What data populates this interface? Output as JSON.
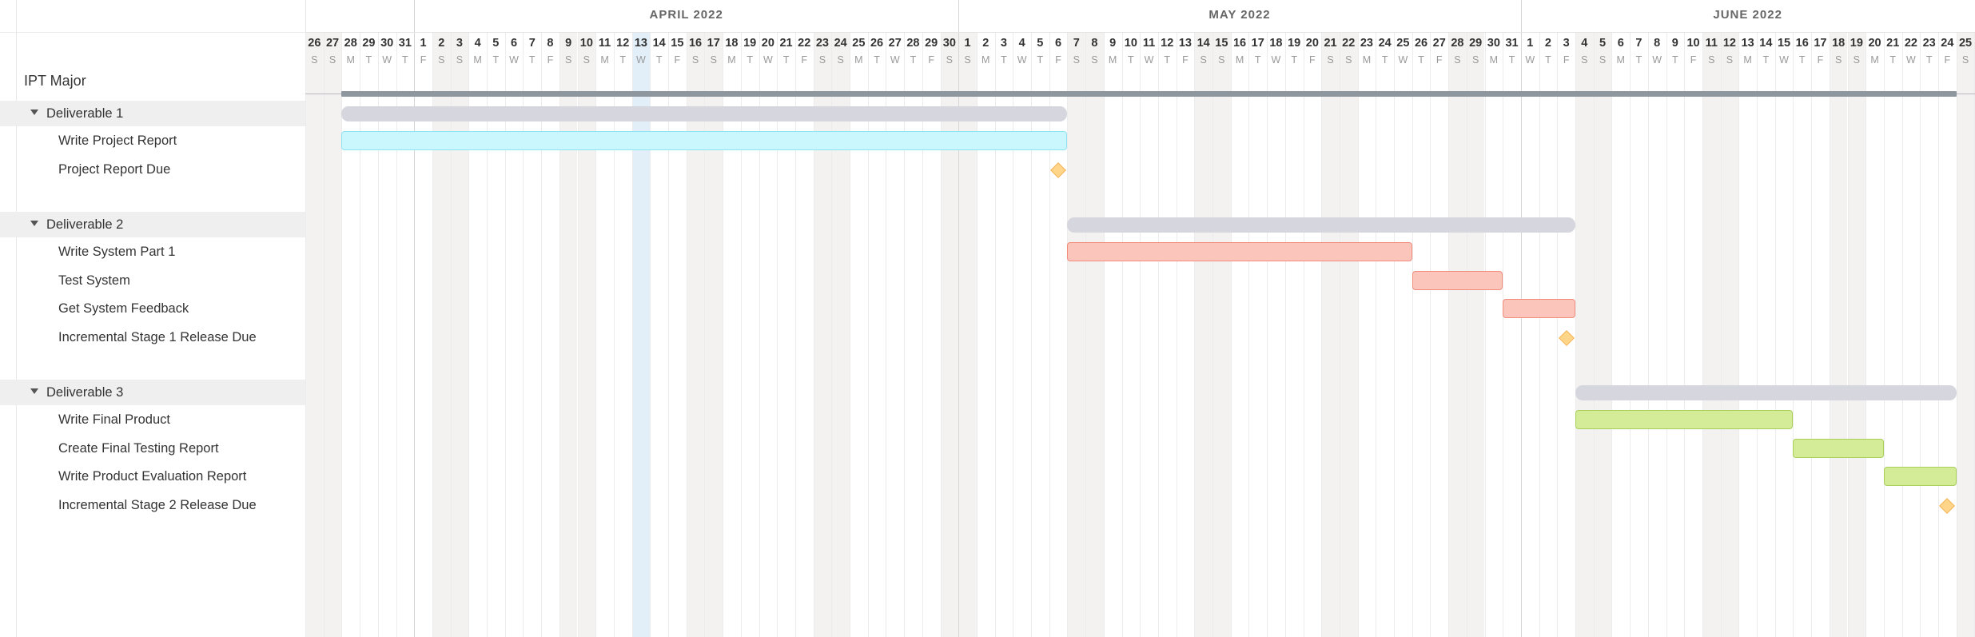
{
  "project": {
    "title": "IPT Major"
  },
  "colors": {
    "project_bar": "#8e969e",
    "summary_bar": "#d6d6de",
    "deliverable1": "#c9f7fd",
    "deliverable2": "#fcc5bb",
    "deliverable3": "#d4ec98",
    "milestone": "#ffd58a",
    "weekend": "#f3f2f0",
    "today": "#e2eff8"
  },
  "icons": {
    "group_toggle": "caret-down-icon",
    "milestone": "diamond-icon"
  },
  "timeline": {
    "months": [
      {
        "label": "APRIL 2022",
        "start": "2022-04-01",
        "end": "2022-04-30"
      },
      {
        "label": "MAY 2022",
        "start": "2022-05-01",
        "end": "2022-05-31"
      },
      {
        "label": "JUNE 2022",
        "start": "2022-06-01",
        "end": "2022-06-25"
      }
    ],
    "visible_start": "2022-03-26",
    "visible_end": "2022-06-26",
    "highlighted_day": "2022-04-13",
    "day_letters": [
      "S",
      "M",
      "T",
      "W",
      "T",
      "F",
      "S"
    ]
  },
  "groups": [
    {
      "label": "Deliverable 1",
      "start": "2022-03-28",
      "end": "2022-05-06",
      "tasks": [
        {
          "label": "Write Project Report",
          "start": "2022-03-28",
          "end": "2022-05-06",
          "color_key": "deliverable1"
        },
        {
          "label": "Project Report Due",
          "milestone": "2022-05-06"
        }
      ]
    },
    {
      "label": "Deliverable 2",
      "start": "2022-05-07",
      "end": "2022-06-03",
      "tasks": [
        {
          "label": "Write System Part 1",
          "start": "2022-05-07",
          "end": "2022-05-25",
          "color_key": "deliverable2"
        },
        {
          "label": "Test System",
          "start": "2022-05-26",
          "end": "2022-05-30",
          "color_key": "deliverable2"
        },
        {
          "label": "Get System Feedback",
          "start": "2022-05-31",
          "end": "2022-06-03",
          "color_key": "deliverable2"
        },
        {
          "label": "Incremental Stage 1 Release Due",
          "milestone": "2022-06-03"
        }
      ]
    },
    {
      "label": "Deliverable 3",
      "start": "2022-06-04",
      "end": "2022-06-24",
      "tasks": [
        {
          "label": "Write Final Product",
          "start": "2022-06-04",
          "end": "2022-06-15",
          "color_key": "deliverable3"
        },
        {
          "label": "Create Final Testing Report",
          "start": "2022-06-16",
          "end": "2022-06-20",
          "color_key": "deliverable3"
        },
        {
          "label": "Write Product Evaluation Report",
          "start": "2022-06-21",
          "end": "2022-06-24",
          "color_key": "deliverable3"
        },
        {
          "label": "Incremental Stage 2 Release Due",
          "milestone": "2022-06-24"
        }
      ]
    }
  ],
  "project_span": {
    "start": "2022-03-28",
    "end": "2022-06-24"
  }
}
